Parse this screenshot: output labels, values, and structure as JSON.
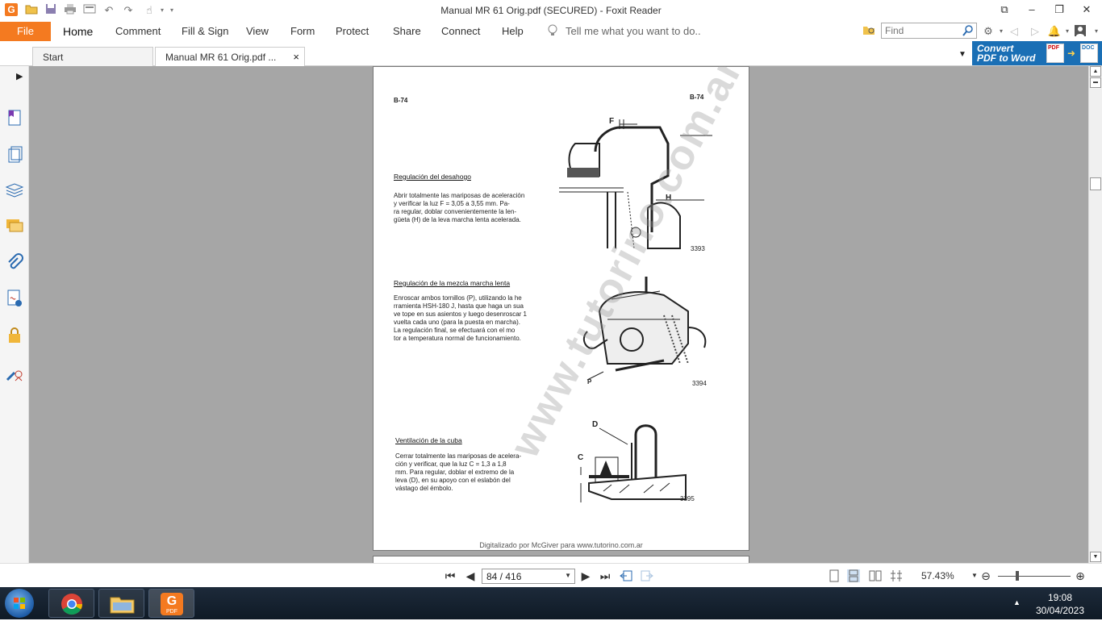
{
  "window": {
    "title": "Manual MR 61 Orig.pdf (SECURED) - Foxit Reader"
  },
  "ribbon": {
    "file": "File",
    "tabs": [
      "Home",
      "Comment",
      "Fill & Sign",
      "View",
      "Form",
      "Protect",
      "Share",
      "Connect",
      "Help"
    ],
    "tell_me": "Tell me what you want to do..",
    "find_placeholder": "Find"
  },
  "doc_tabs": {
    "start": "Start",
    "active": "Manual MR 61 Orig.pdf ...",
    "close": "×"
  },
  "convert": {
    "line1": "Convert",
    "line2": "PDF to Word",
    "badge_pdf": "PDF",
    "badge_doc": "DOC"
  },
  "pdf_page": {
    "page_label_left": "B-74",
    "page_label_right": "B-74",
    "section1_title": "Regulación del desahogo",
    "section1_lines": [
      "Abrir totalmente las mariposas de aceleración",
      "y verificar la luz F = 3,05 a 3,55 mm. Pa-",
      "ra regular, doblar convenientemente la len-",
      "güeta (H) de la leva marcha lenta acelerada."
    ],
    "fig1_num": "3393",
    "fig1_label_f": "F",
    "fig1_label_h": "H",
    "section2_title": "Regulación de la mezcla marcha lenta",
    "section2_lines": [
      "Enroscar ambos tornillos (P), utilizando la he",
      "rramienta HSH-180 J, hasta que haga un sua",
      "ve tope en sus asientos y luego desenroscar 1",
      "vuelta cada uno (para la puesta en marcha).",
      "La regulación final, se efectuará con el mo",
      "tor a temperatura normal de funcionamiento."
    ],
    "fig2_num": "3394",
    "fig2_label_p": "P",
    "section3_title": "Ventilación de la cuba",
    "section3_lines": [
      "Cerrar totalmente las mariposas de acelera-",
      "ción y verificar, que la luz C = 1,3 a 1,8",
      "mm. Para regular, doblar el extremo de la",
      "leva (D), en su apoyo con el eslabón del",
      "vástago del émbolo."
    ],
    "fig3_num": "3395",
    "fig3_label_c": "C",
    "fig3_label_d": "D",
    "watermark": "www.tutorino.com.ar",
    "footer": "Digitalizado por McGiver para www.tutorino.com.ar"
  },
  "statusbar": {
    "page_field": "84 / 416",
    "zoom": "57.43%"
  },
  "taskbar": {
    "time": "19:08",
    "date": "30/04/2023",
    "foxit_label": "PDF"
  }
}
